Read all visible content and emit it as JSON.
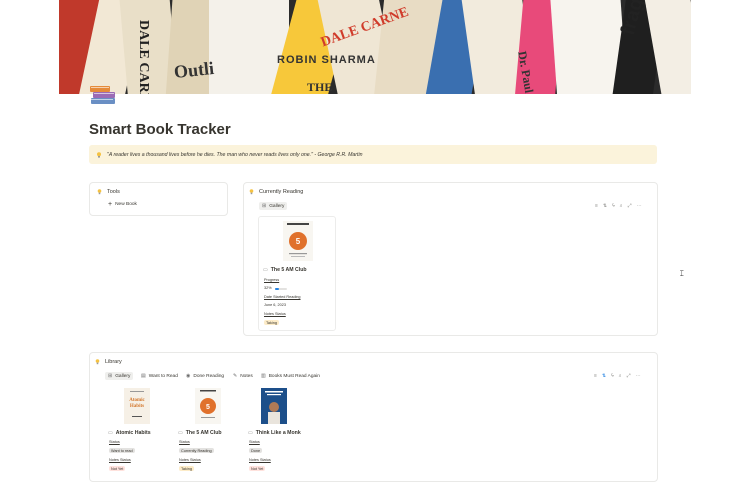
{
  "cover": {
    "words": [
      "DALE CARNEGIE",
      "Outli",
      "ROBIN SHARMA",
      "THE",
      "DALE CARNE",
      "Dr. Paul",
      "fragile"
    ]
  },
  "page": {
    "title": "Smart Book Tracker"
  },
  "callout": {
    "quote": "\"A reader lives a thousand lives before he dies. The man who never reads lives only one.\" - George R.R. Martin"
  },
  "tools": {
    "title": "Tools",
    "new_book": "New Book"
  },
  "currently_reading": {
    "title": "Currently Reading",
    "tab": "Gallery",
    "toolbar_icons": [
      "filter-icon",
      "sort-icon",
      "automation-icon",
      "search-icon",
      "expand-icon",
      "more-icon"
    ],
    "card": {
      "title": "The 5 AM Club",
      "progress_label": "Progress",
      "progress_value": "32%",
      "progress_fraction": 0.32,
      "date_label": "Date Started Reading",
      "date_value": "June 6, 2023",
      "notes_label": "Notes Status",
      "notes_value": "Taking"
    }
  },
  "library": {
    "title": "Library",
    "tabs": [
      {
        "label": "Gallery",
        "icon": "gallery-icon"
      },
      {
        "label": "Want to Read",
        "icon": "want-to-read-icon"
      },
      {
        "label": "Done Reading",
        "icon": "done-reading-icon"
      },
      {
        "label": "Notes",
        "icon": "notes-icon"
      },
      {
        "label": "Books Must Read Again",
        "icon": "books-must-read-again-icon"
      }
    ],
    "cards": [
      {
        "title": "Atomic Habits",
        "status_label": "Status",
        "status": "Want to read",
        "notes_label": "Notes Status",
        "notes": "Not Yet"
      },
      {
        "title": "The 5 AM Club",
        "status_label": "Status",
        "status": "Currently Reading",
        "notes_label": "Notes Status",
        "notes": "Taking"
      },
      {
        "title": "Think Like a Monk",
        "status_label": "Status",
        "status": "Done",
        "notes_label": "Notes Status",
        "notes": "Not Yet"
      }
    ]
  },
  "colors": {
    "callout_bg": "#fbf3db",
    "accent": "#2383e2",
    "tag_not_yet": "#ffe2dd",
    "tag_taking": "#fdecc8",
    "tag_gray": "#e3e2e0"
  }
}
